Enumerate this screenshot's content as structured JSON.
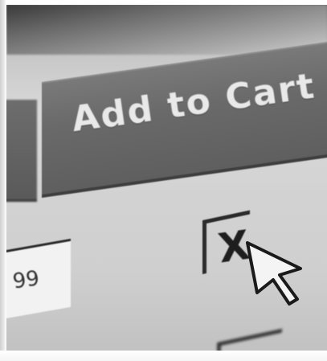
{
  "cart_button": {
    "label": "Add to Cart"
  },
  "price_field": {
    "partial_text": "99"
  },
  "remove_control": {
    "glyph": "X",
    "icon": "close-icon"
  },
  "cursor": {
    "icon": "arrow-cursor-icon"
  },
  "colors": {
    "button": "#6a6a6a",
    "button_text": "#e9e9e9",
    "field": "#f2f2f2",
    "screen": "#d6d6d6"
  }
}
